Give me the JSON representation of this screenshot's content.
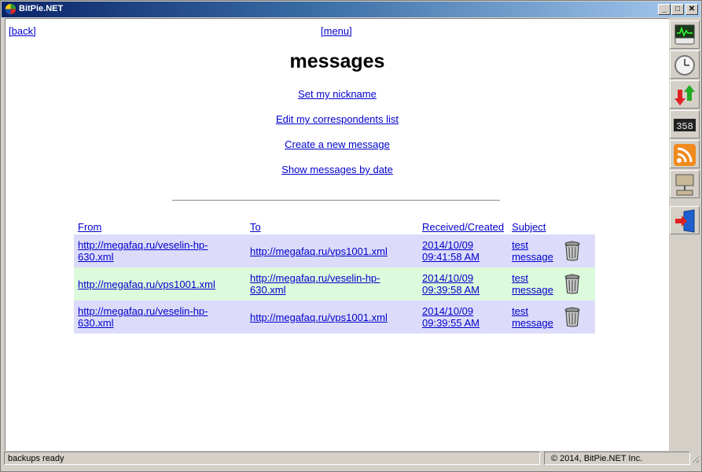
{
  "window": {
    "title": "BitPie.NET",
    "minimize_glyph": "_",
    "maximize_glyph": "□",
    "close_glyph": "✕"
  },
  "nav": {
    "back": "[back]",
    "menu": "[menu]"
  },
  "page_title": "messages",
  "actions": [
    {
      "label": "Set my nickname"
    },
    {
      "label": "Edit my correspondents list"
    },
    {
      "label": "Create a new message"
    },
    {
      "label": "Show messages by date"
    }
  ],
  "table": {
    "headers": {
      "from": "From",
      "to": "To",
      "received": "Received/Created",
      "subject": "Subject"
    },
    "rows": [
      {
        "from": "http://megafaq.ru/veselin-hp-630.xml",
        "to": "http://megafaq.ru/vps1001.xml",
        "date": "2014/10/09",
        "time": "09:41:58 AM",
        "subject_1": "test",
        "subject_2": "message",
        "color": "#dcdcfa"
      },
      {
        "from": "http://megafaq.ru/vps1001.xml",
        "to": "http://megafaq.ru/veselin-hp-630.xml",
        "date": "2014/10/09",
        "time": "09:39:58 AM",
        "subject_1": "test",
        "subject_2": "message",
        "color": "#dcfadc"
      },
      {
        "from": "http://megafaq.ru/veselin-hp-630.xml",
        "to": "http://megafaq.ru/vps1001.xml",
        "date": "2014/10/09",
        "time": "09:39:55 AM",
        "subject_1": "test",
        "subject_2": "message",
        "color": "#dcdcfa"
      }
    ]
  },
  "sidebar": {
    "buttons": [
      {
        "icon": "monitor-icon"
      },
      {
        "icon": "clock-icon"
      },
      {
        "icon": "transfer-arrows-icon"
      },
      {
        "icon": "counter-icon",
        "text": "358"
      },
      {
        "icon": "rss-icon"
      },
      {
        "icon": "network-computer-icon"
      },
      {
        "icon": "exit-door-icon"
      }
    ]
  },
  "status": {
    "left": "backups ready",
    "right": "© 2014, BitPie.NET Inc."
  },
  "colors": {
    "link": "#0000cc",
    "row_a": "#dcdcfa",
    "row_b": "#dcfadc",
    "title_bar": "#0a246a"
  }
}
